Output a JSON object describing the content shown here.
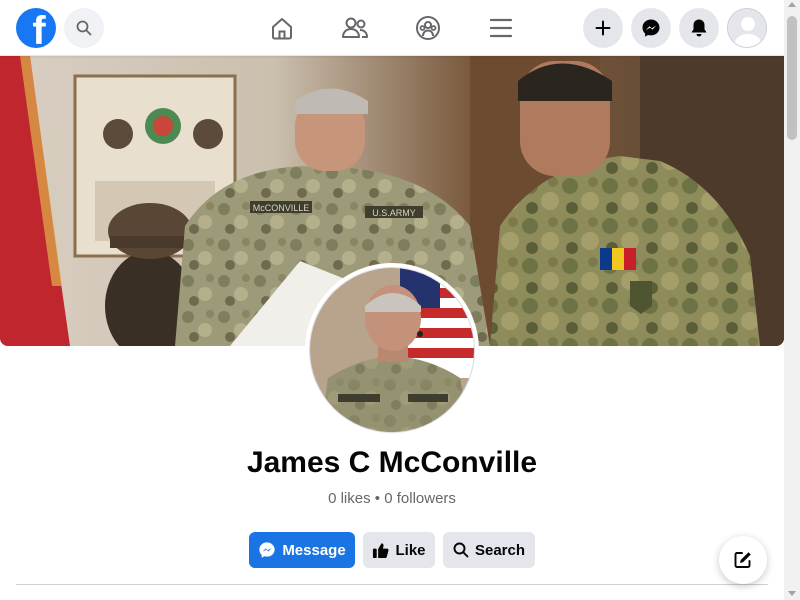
{
  "nav": {
    "logo_letter": "f",
    "icons": [
      "search-icon",
      "home-icon",
      "friends-icon",
      "groups-icon",
      "menu-icon",
      "plus-icon",
      "messenger-icon",
      "bell-icon",
      "avatar-icon"
    ]
  },
  "profile": {
    "name": "James C McConville",
    "likes": "0 likes",
    "separator": "•",
    "followers": "0 followers"
  },
  "actions": {
    "message_label": "Message",
    "like_label": "Like",
    "search_label": "Search"
  },
  "cover_labels": {
    "nametape": "McCONVILLE",
    "branch": "U.S.ARMY"
  },
  "colors": {
    "brand": "#1877f2",
    "message_button": "#1b74e4",
    "secondary_button": "#e4e6eb",
    "muted_text": "#65676b"
  }
}
